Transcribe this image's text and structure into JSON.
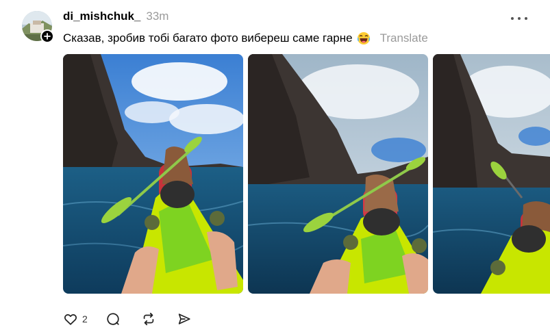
{
  "post": {
    "username": "di_mishchuk_",
    "timestamp": "33m",
    "caption": "Сказав, зробив тобі багато фото вибереш саме гарне",
    "translate_label": "Translate",
    "media_count": 3
  },
  "actions": {
    "like_count": "2"
  },
  "icons": {
    "follow": "plus-icon",
    "more": "more-horizontal-icon",
    "like": "heart-icon",
    "reply": "comment-icon",
    "repost": "repost-icon",
    "share": "send-icon",
    "emoji": "laughing-face-emoji"
  },
  "colors": {
    "text": "#000000",
    "muted": "#9a9a9a",
    "icon": "#222222",
    "kayak": "#c8e600"
  }
}
